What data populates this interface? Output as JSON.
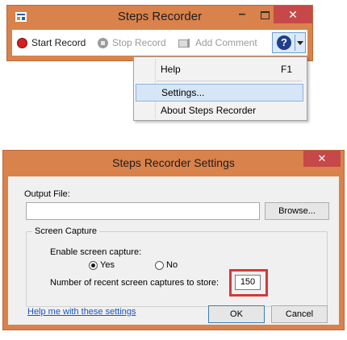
{
  "recorder": {
    "title": "Steps Recorder",
    "minimize_glyph": "–",
    "close_glyph": "✕",
    "start_label": "Start Record",
    "stop_label": "Stop Record",
    "comment_label": "Add Comment",
    "help_glyph": "?"
  },
  "help_menu": {
    "items": [
      {
        "label": "Help",
        "shortcut": "F1"
      },
      {
        "label": "Settings..."
      },
      {
        "label": "About Steps Recorder"
      }
    ]
  },
  "settings_dialog": {
    "title": "Steps Recorder Settings",
    "close_glyph": "✕",
    "output_file_label": "Output File:",
    "output_file_value": "",
    "browse_label": "Browse...",
    "group_title": "Screen Capture",
    "enable_label": "Enable screen capture:",
    "yes_label": "Yes",
    "no_label": "No",
    "enable_selected": "Yes",
    "count_label": "Number of recent screen captures to store:",
    "count_value": "150",
    "help_link": "Help me with these settings",
    "ok_label": "OK",
    "cancel_label": "Cancel"
  },
  "colors": {
    "title_bar": "#d9824c",
    "close_button": "#c74848",
    "highlight_box": "#d23a3a",
    "link": "#1a53c4"
  },
  "icons": {
    "app": "steps-recorder-app-icon",
    "start": "record-dot-icon",
    "stop": "stop-icon",
    "comment": "comment-icon",
    "help": "help-question-icon",
    "dropdown": "chevron-down-icon"
  }
}
